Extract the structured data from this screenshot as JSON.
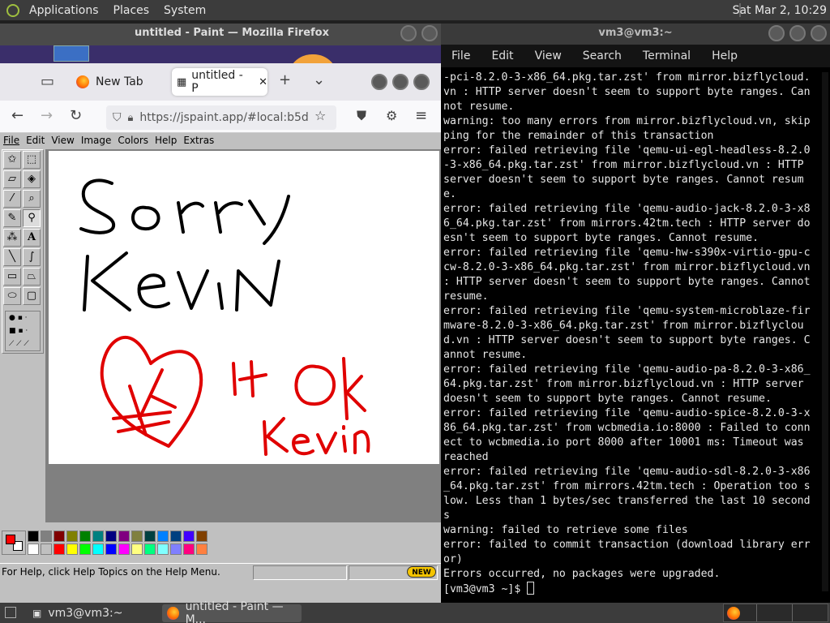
{
  "top_panel": {
    "menus": [
      "Applications",
      "Places",
      "System"
    ],
    "clock": "Sat Mar 2, 10:29"
  },
  "firefox_back": {
    "title": "untitled - Paint — Mozilla Firefox"
  },
  "terminal": {
    "title": "vm3@vm3:~",
    "menu": [
      "File",
      "Edit",
      "View",
      "Search",
      "Terminal",
      "Help"
    ],
    "lines": [
      "-pci-8.2.0-3-x86_64.pkg.tar.zst' from mirror.bizflycloud.vn : HTTP server doesn't seem to support byte ranges. Cannot resume.",
      "warning: too many errors from mirror.bizflycloud.vn, skipping for the remainder of this transaction",
      "error: failed retrieving file 'qemu-ui-egl-headless-8.2.0-3-x86_64.pkg.tar.zst' from mirror.bizflycloud.vn : HTTP server doesn't seem to support byte ranges. Cannot resume.",
      "error: failed retrieving file 'qemu-audio-jack-8.2.0-3-x86_64.pkg.tar.zst' from mirrors.42tm.tech : HTTP server doesn't seem to support byte ranges. Cannot resume.",
      "error: failed retrieving file 'qemu-hw-s390x-virtio-gpu-ccw-8.2.0-3-x86_64.pkg.tar.zst' from mirror.bizflycloud.vn : HTTP server doesn't seem to support byte ranges. Cannot resume.",
      "error: failed retrieving file 'qemu-system-microblaze-firmware-8.2.0-3-x86_64.pkg.tar.zst' from mirror.bizflycloud.vn : HTTP server doesn't seem to support byte ranges. Cannot resume.",
      "error: failed retrieving file 'qemu-audio-pa-8.2.0-3-x86_64.pkg.tar.zst' from mirror.bizflycloud.vn : HTTP server doesn't seem to support byte ranges. Cannot resume.",
      "error: failed retrieving file 'qemu-audio-spice-8.2.0-3-x86_64.pkg.tar.zst' from wcbmedia.io:8000 : Failed to connect to wcbmedia.io port 8000 after 10001 ms: Timeout was reached",
      "error: failed retrieving file 'qemu-audio-sdl-8.2.0-3-x86_64.pkg.tar.zst' from mirrors.42tm.tech : Operation too slow. Less than 1 bytes/sec transferred the last 10 seconds",
      "warning: failed to retrieve some files",
      "error: failed to commit transaction (download library error)",
      "Errors occurred, no packages were upgraded.",
      "[vm3@vm3 ~]$ "
    ]
  },
  "firefox": {
    "tabs": [
      {
        "label": "New Tab"
      },
      {
        "label": "untitled - P"
      }
    ],
    "url": "https://jspaint.app/#local:b5d"
  },
  "paint": {
    "menu": [
      "File",
      "Edit",
      "View",
      "Image",
      "Colors",
      "Help",
      "Extras"
    ],
    "status": "For Help, click Help Topics on the Help Menu.",
    "new_badge": "NEW",
    "primary_color": "#ff0000",
    "secondary_color": "#ffffff",
    "palette": [
      "#000000",
      "#808080",
      "#800000",
      "#808000",
      "#008000",
      "#008080",
      "#000080",
      "#800080",
      "#808040",
      "#004040",
      "#0080ff",
      "#004080",
      "#4000ff",
      "#804000",
      "#ffffff",
      "#c0c0c0",
      "#ff0000",
      "#ffff00",
      "#00ff00",
      "#00ffff",
      "#0000ff",
      "#ff00ff",
      "#ffff80",
      "#00ff80",
      "#80ffff",
      "#8080ff",
      "#ff0080",
      "#ff8040"
    ],
    "tools": [
      "free-select",
      "select",
      "eraser",
      "fill",
      "picker",
      "magnifier",
      "pencil",
      "brush",
      "airbrush",
      "text",
      "line",
      "curve",
      "rectangle",
      "polygon",
      "ellipse",
      "rounded-rectangle"
    ]
  },
  "taskbar": {
    "items": [
      {
        "label": "vm3@vm3:~"
      },
      {
        "label": "untitled - Paint — M..."
      }
    ]
  }
}
